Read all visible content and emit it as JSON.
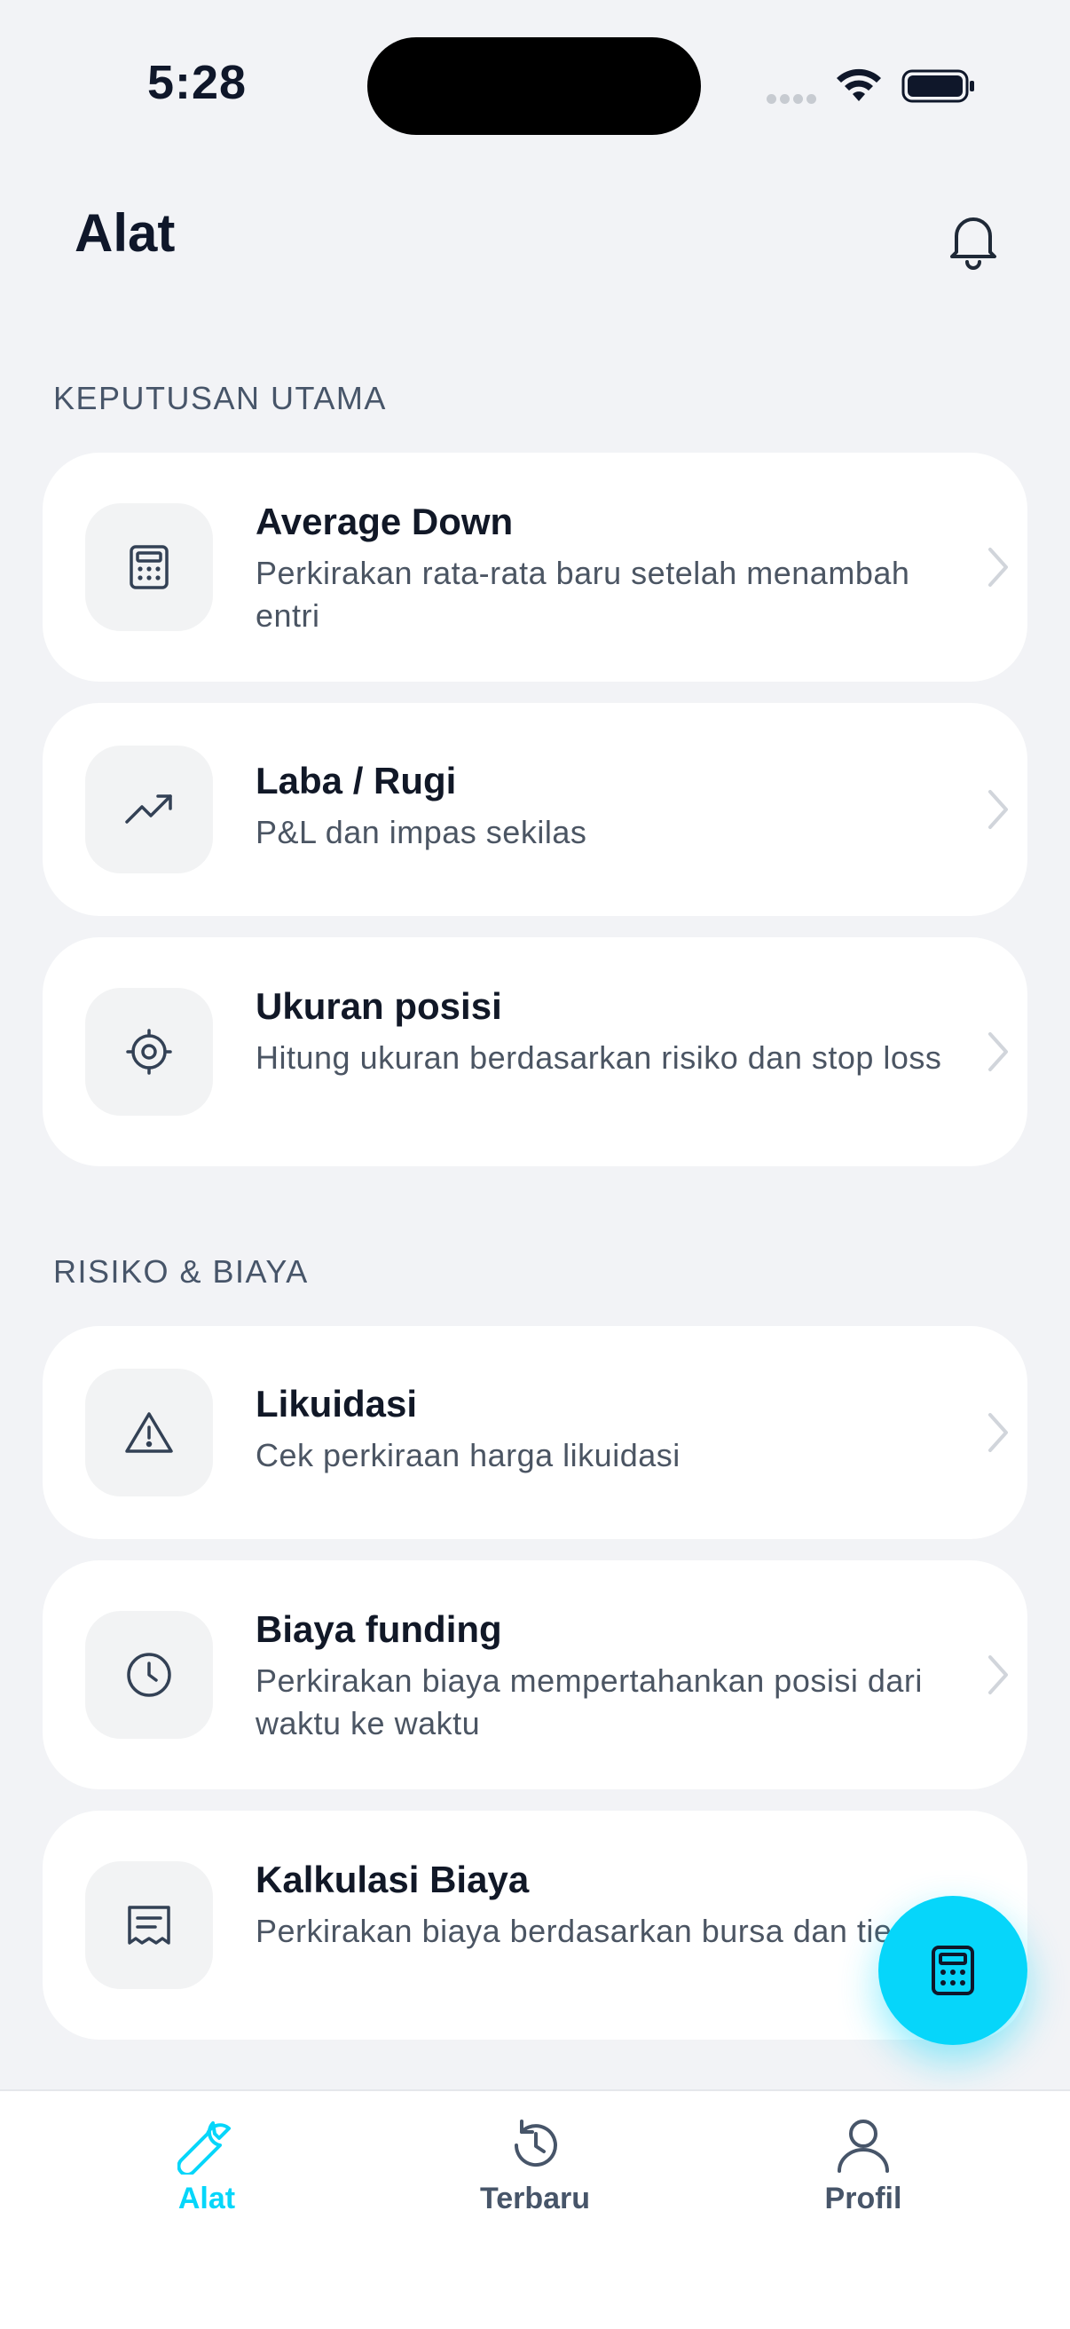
{
  "status_bar": {
    "time": "5:28"
  },
  "header": {
    "title": "Alat",
    "notification_icon": "bell-icon"
  },
  "sections": [
    {
      "label": "KEPUTUSAN UTAMA",
      "items": [
        {
          "icon": "calculator-icon",
          "title": "Average Down",
          "description": "Perkirakan rata-rata baru setelah menambah entri"
        },
        {
          "icon": "trending-up-icon",
          "title": "Laba / Rugi",
          "description": "P&L dan impas sekilas"
        },
        {
          "icon": "crosshair-icon",
          "title": "Ukuran posisi",
          "description": "Hitung ukuran berdasarkan risiko dan stop loss"
        }
      ]
    },
    {
      "label": "RISIKO & BIAYA",
      "items": [
        {
          "icon": "warning-icon",
          "title": "Likuidasi",
          "description": "Cek perkiraan harga likuidasi"
        },
        {
          "icon": "clock-icon",
          "title": "Biaya funding",
          "description": "Perkirakan biaya mempertahankan posisi dari waktu ke waktu"
        },
        {
          "icon": "receipt-icon",
          "title": "Kalkulasi Biaya",
          "description": "Perkirakan biaya berdasarkan bursa dan tier"
        }
      ]
    }
  ],
  "fab": {
    "icon": "calculator-icon"
  },
  "tabbar": {
    "items": [
      {
        "label": "Alat",
        "icon": "wrench-icon",
        "active": true
      },
      {
        "label": "Terbaru",
        "icon": "history-icon",
        "active": false
      },
      {
        "label": "Profil",
        "icon": "user-icon",
        "active": false
      }
    ]
  },
  "colors": {
    "accent": "#06d6fa",
    "text": "#111827",
    "muted": "#4b5563",
    "background": "#f2f3f6"
  }
}
